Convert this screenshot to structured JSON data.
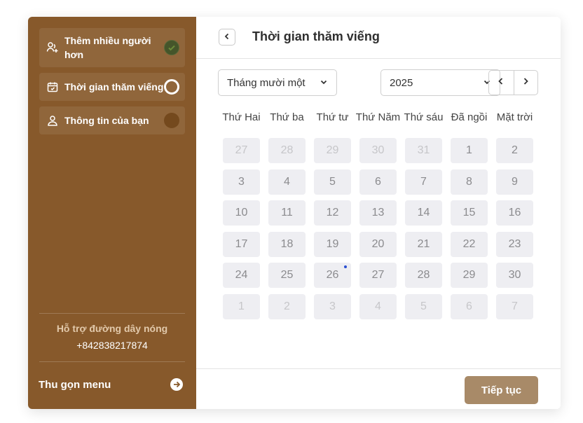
{
  "sidebar": {
    "steps": [
      {
        "label": "Thêm nhiều người hơn",
        "icon": "add-user-icon",
        "status": "done"
      },
      {
        "label": "Thời gian thăm viếng",
        "icon": "calendar-icon",
        "status": "current"
      },
      {
        "label": "Thông tin của bạn",
        "icon": "user-icon",
        "status": "pending"
      }
    ],
    "hotline_title": "Hỗ trợ đường dây nóng",
    "hotline_number": "+842838217874",
    "collapse_label": "Thu gọn menu",
    "collapse_icon": "arrow-right-circle-icon"
  },
  "header": {
    "back_icon": "chevron-left-icon",
    "title": "Thời gian thăm viếng"
  },
  "calendar": {
    "month_select": "Tháng mười một",
    "year_select": "2025",
    "prev_icon": "chevron-left-icon",
    "next_icon": "chevron-right-icon",
    "weekdays": [
      "Thứ Hai",
      "Thứ ba",
      "Thứ tư",
      "Thứ Năm",
      "Thứ sáu",
      "Đã ngồi",
      "Mặt trời"
    ],
    "weeks": [
      [
        {
          "d": "27",
          "muted": true
        },
        {
          "d": "28",
          "muted": true
        },
        {
          "d": "29",
          "muted": true
        },
        {
          "d": "30",
          "muted": true
        },
        {
          "d": "31",
          "muted": true
        },
        {
          "d": "1"
        },
        {
          "d": "2"
        }
      ],
      [
        {
          "d": "3"
        },
        {
          "d": "4"
        },
        {
          "d": "5"
        },
        {
          "d": "6"
        },
        {
          "d": "7"
        },
        {
          "d": "8"
        },
        {
          "d": "9"
        }
      ],
      [
        {
          "d": "10"
        },
        {
          "d": "11"
        },
        {
          "d": "12"
        },
        {
          "d": "13"
        },
        {
          "d": "14"
        },
        {
          "d": "15"
        },
        {
          "d": "16"
        }
      ],
      [
        {
          "d": "17"
        },
        {
          "d": "18"
        },
        {
          "d": "19"
        },
        {
          "d": "20"
        },
        {
          "d": "21"
        },
        {
          "d": "22"
        },
        {
          "d": "23"
        }
      ],
      [
        {
          "d": "24"
        },
        {
          "d": "25"
        },
        {
          "d": "26",
          "today": true
        },
        {
          "d": "27"
        },
        {
          "d": "28"
        },
        {
          "d": "29"
        },
        {
          "d": "30"
        }
      ],
      [
        {
          "d": "1",
          "muted": true
        },
        {
          "d": "2",
          "muted": true
        },
        {
          "d": "3",
          "muted": true
        },
        {
          "d": "4",
          "muted": true
        },
        {
          "d": "5",
          "muted": true
        },
        {
          "d": "6",
          "muted": true
        },
        {
          "d": "7",
          "muted": true
        }
      ]
    ]
  },
  "footer": {
    "continue_label": "Tiếp tục"
  },
  "colors": {
    "sidebar_bg": "#87592b",
    "primary_button": "#a88a68",
    "today_dot": "#2a4fd1"
  }
}
